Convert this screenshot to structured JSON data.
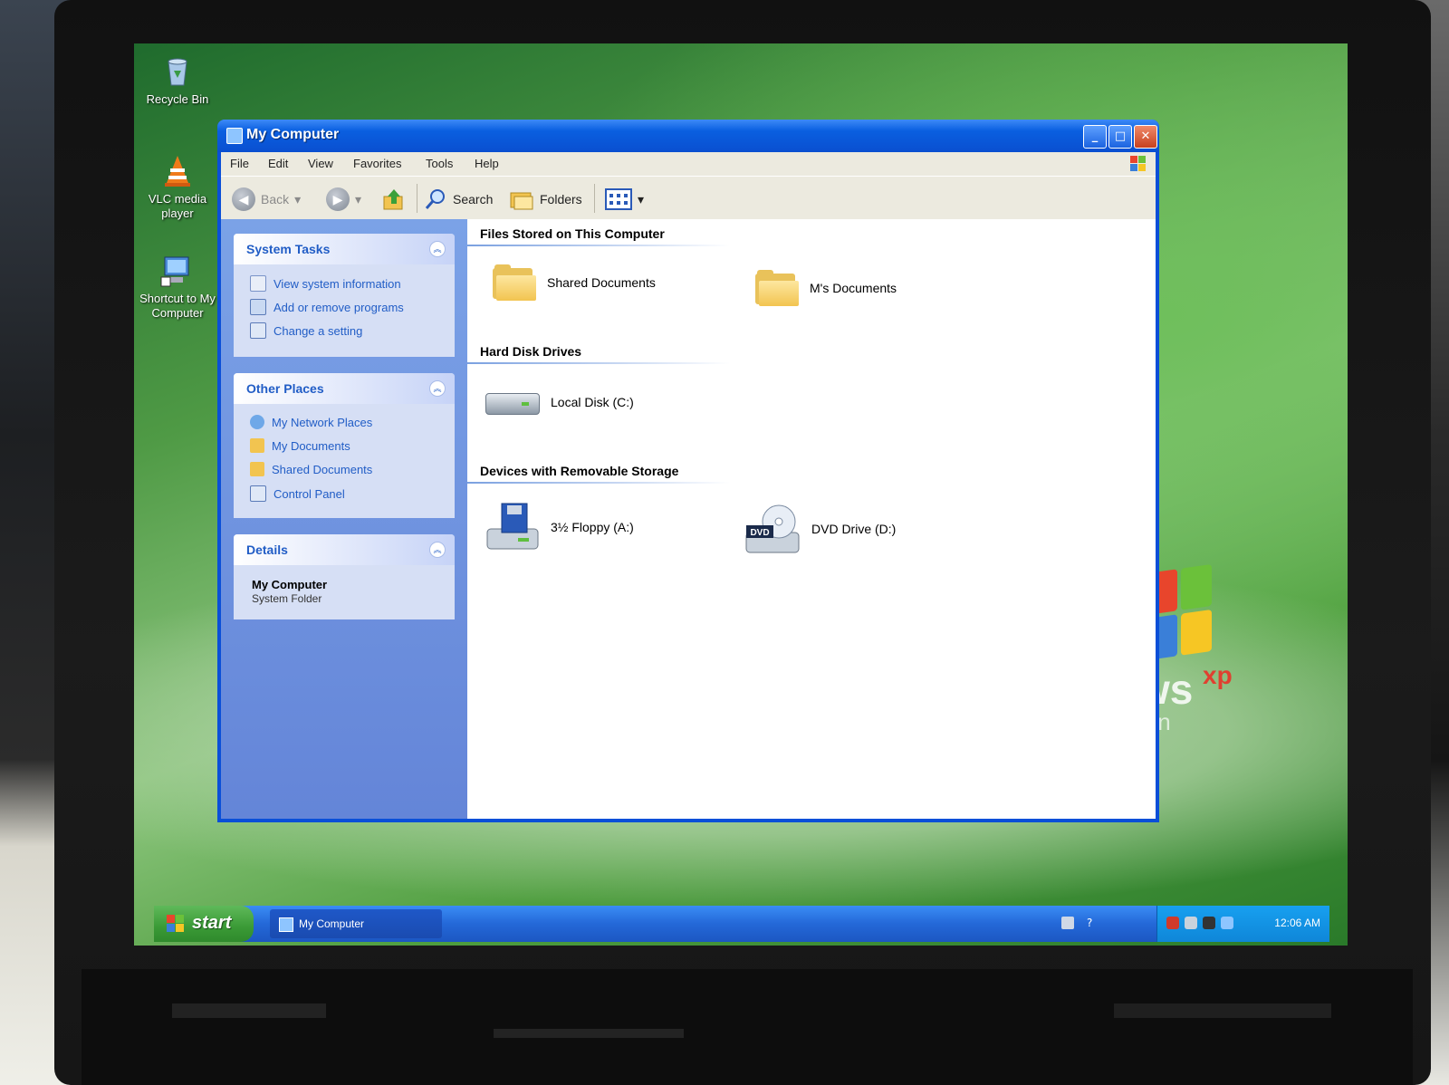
{
  "desktop": {
    "icons": [
      {
        "label": "Recycle Bin",
        "icon": "recycle-bin-icon"
      },
      {
        "label": "VLC media player",
        "icon": "vlc-cone-icon"
      },
      {
        "label": "Shortcut to My Computer",
        "icon": "computer-shortcut-icon"
      }
    ],
    "watermark": {
      "text": "ws",
      "suffix": "xp",
      "edition": "ion"
    }
  },
  "window": {
    "title": "My Computer",
    "controls": {
      "minimize": "_",
      "maximize": "□",
      "close": "✕"
    },
    "menu": [
      "File",
      "Edit",
      "View",
      "Favorites",
      "Tools",
      "Help"
    ],
    "toolbar": {
      "back": "Back",
      "forward": "",
      "up": "",
      "search": "Search",
      "folders": "Folders",
      "views": ""
    },
    "sidebar": {
      "system_tasks": {
        "title": "System Tasks",
        "items": [
          "View system information",
          "Add or remove programs",
          "Change a setting"
        ]
      },
      "other_places": {
        "title": "Other Places",
        "items": [
          "My Network Places",
          "My Documents",
          "Shared Documents",
          "Control Panel"
        ]
      },
      "details": {
        "title": "Details",
        "name": "My Computer",
        "type": "System Folder"
      }
    },
    "content": {
      "groups": [
        {
          "title": "Files Stored on This Computer",
          "items": [
            "Shared Documents",
            "M's Documents"
          ]
        },
        {
          "title": "Hard Disk Drives",
          "items": [
            "Local Disk (C:)"
          ]
        },
        {
          "title": "Devices with Removable Storage",
          "items": [
            "3½ Floppy (A:)",
            "DVD Drive (D:)"
          ]
        }
      ]
    }
  },
  "taskbar": {
    "start": "start",
    "task": "My Computer",
    "clock": "12:06 AM"
  },
  "colors": {
    "title_blue": "#0a4fd8",
    "sidebar_blue": "#6f94df",
    "link_blue": "#215dc6",
    "start_green": "#3a9a36",
    "desktop_green": "#4f9a45"
  }
}
